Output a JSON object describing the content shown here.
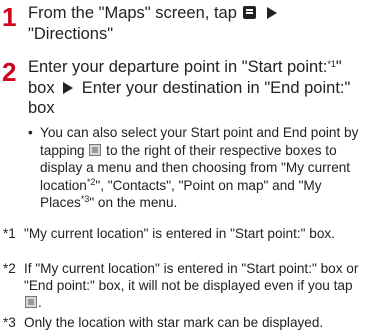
{
  "steps": [
    {
      "number": "1",
      "text_a": "From the \"Maps\" screen, tap",
      "text_b": "\"Directions\""
    },
    {
      "number": "2",
      "text_a": "Enter your departure point in \"Start point:",
      "sup_a": "*1",
      "text_b": "\" box",
      "text_c": "Enter your destination in \"End point:\" box"
    }
  ],
  "bullet": {
    "marker": "•",
    "text_a": "You can also select your Start point and End point by tapping",
    "text_b": "to the right of their respective boxes to display a menu and then choosing from \"My current location",
    "sup_b": "*2",
    "text_c": "\", \"Contacts\", \"Point on map\" and \"My Places",
    "sup_c": "*3",
    "text_d": "\" on the menu."
  },
  "notes": [
    {
      "mark": "*1",
      "text": "\"My current location\" is entered in \"Start point:\" box."
    },
    {
      "mark": "*2",
      "text_a": "If \"My current location\" is entered in \"Start point:\" box or \"End point:\" box, it will not be displayed even if you tap",
      "text_b": "."
    },
    {
      "mark": "*3",
      "text": "Only the location with star mark can be displayed."
    }
  ],
  "icons": {
    "menu": "menu-key-icon",
    "arrow": "right-arrow-icon",
    "select_button": "select-button-icon"
  },
  "colors": {
    "step_number": "#d0021b",
    "text": "#222222"
  }
}
